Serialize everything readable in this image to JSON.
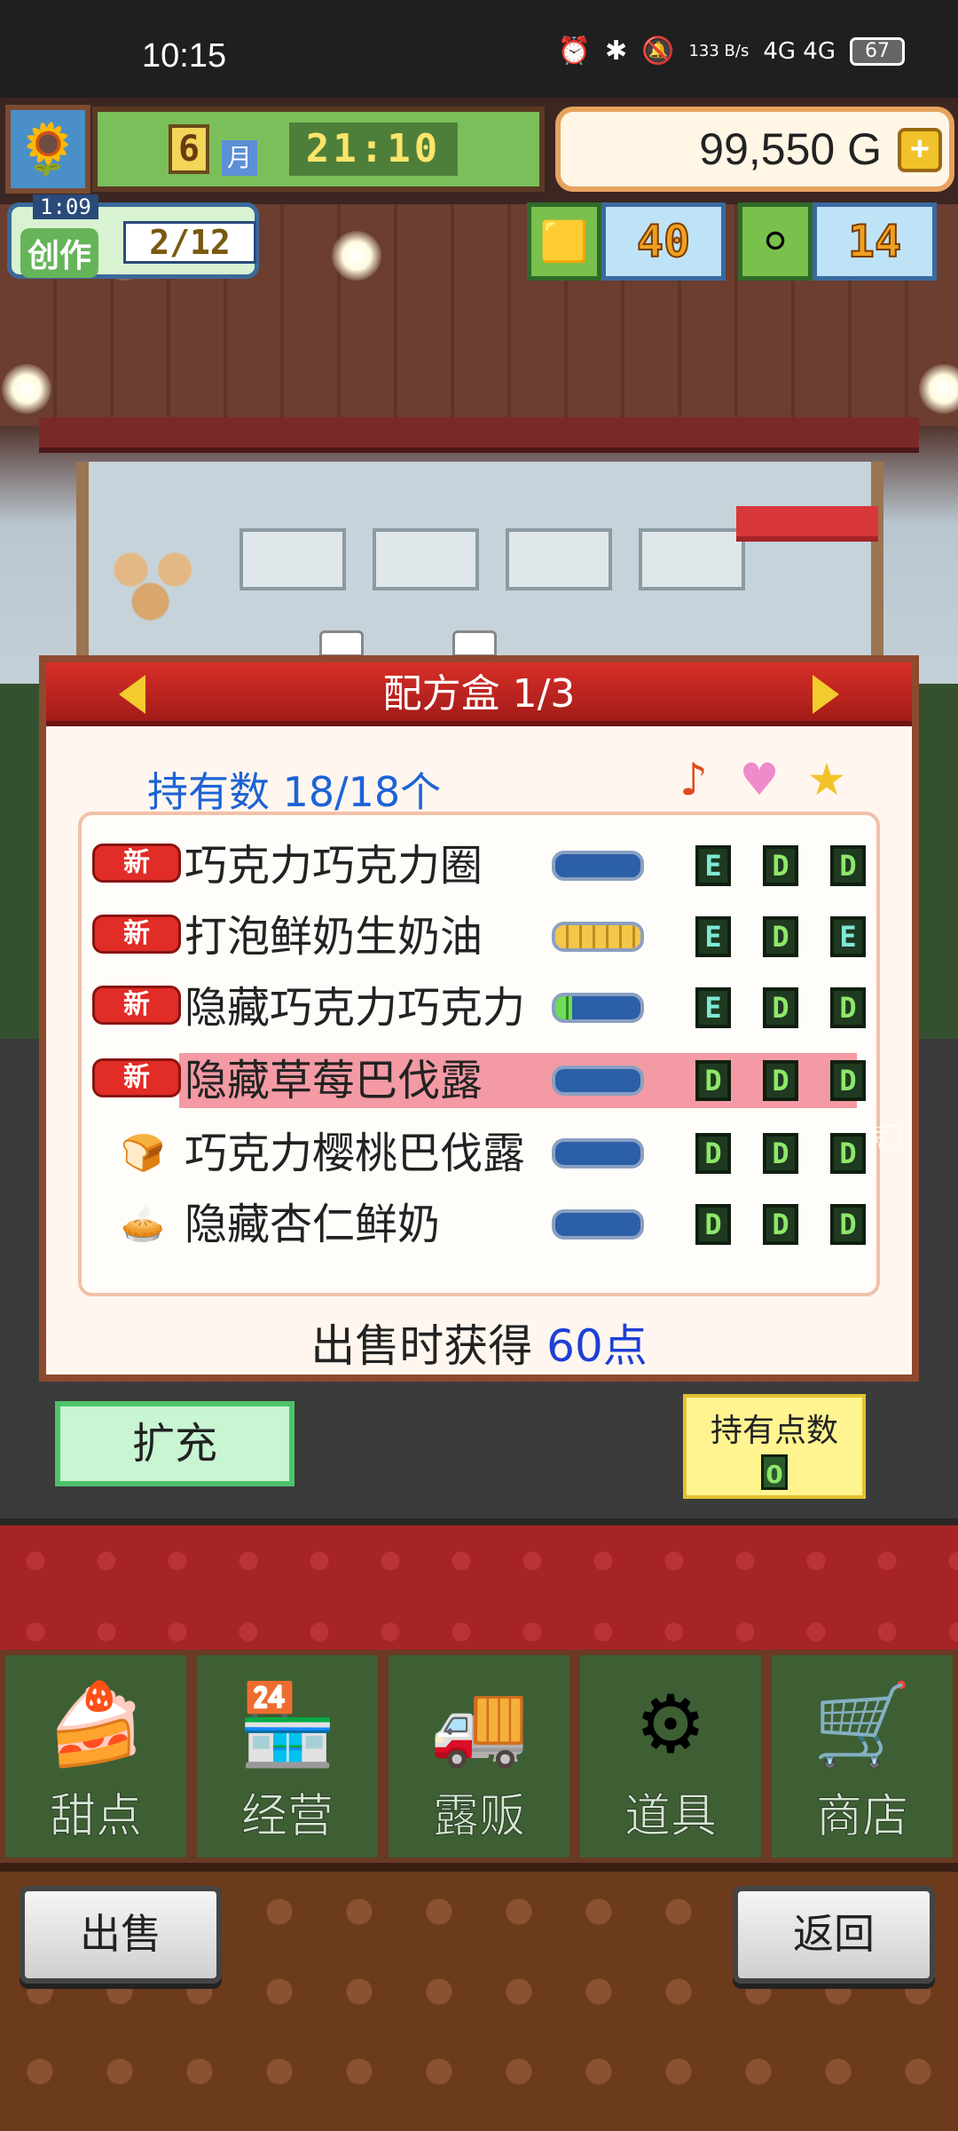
{
  "status_bar": {
    "time": "10:15",
    "speed": "133 B/s",
    "network": "4G 4G",
    "battery": "67"
  },
  "hud": {
    "month_number": "6",
    "month_label": "月",
    "clock": "21:10",
    "money": "99,550 G",
    "money_plus": "+",
    "create_timer": "1:09",
    "create_label": "创作",
    "create_count": "2/12",
    "gold_count": "40",
    "coin_count": "14"
  },
  "panel": {
    "title": "配方盒 1/3",
    "holding_label": "持有数 18/18个",
    "header_icons": [
      "music-note-icon",
      "heart-icon",
      "star-icon"
    ],
    "new_badge": "新",
    "rows": [
      {
        "name": "巧克力巧克力圈",
        "new": true,
        "bar_fill": 0,
        "bar_color": "yellow",
        "grades": [
          "E",
          "D",
          "D"
        ],
        "selected": false
      },
      {
        "name": "打泡鲜奶生奶油",
        "new": true,
        "bar_fill": 1.0,
        "bar_color": "yellow",
        "grades": [
          "E",
          "D",
          "E"
        ],
        "selected": false
      },
      {
        "name": "隐藏巧克力巧克力",
        "new": true,
        "bar_fill": 0.2,
        "bar_color": "green",
        "grades": [
          "E",
          "D",
          "D"
        ],
        "selected": false
      },
      {
        "name": "隐藏草莓巴伐露",
        "new": true,
        "bar_fill": 0,
        "bar_color": "yellow",
        "grades": [
          "D",
          "D",
          "D"
        ],
        "selected": true
      },
      {
        "name": "巧克力樱桃巴伐露",
        "new": false,
        "bar_fill": 0,
        "bar_color": "yellow",
        "grades": [
          "D",
          "D",
          "D"
        ],
        "selected": false
      },
      {
        "name": "隐藏杏仁鲜奶",
        "new": false,
        "bar_fill": 0,
        "bar_color": "yellow",
        "grades": [
          "D",
          "D",
          "D"
        ],
        "selected": false
      }
    ],
    "sale_prefix": "出售时获得",
    "sale_points": "60点"
  },
  "controls": {
    "expand_label": "扩充",
    "points_label": "持有点数",
    "points_value": "0"
  },
  "menu": [
    {
      "label": "甜点",
      "icon": "cake-icon"
    },
    {
      "label": "经营",
      "icon": "shop-building-icon"
    },
    {
      "label": "露贩",
      "icon": "food-truck-icon"
    },
    {
      "label": "道具",
      "icon": "gear-bag-icon"
    },
    {
      "label": "商店",
      "icon": "cart-icon"
    }
  ],
  "footer": {
    "sell_label": "出售",
    "back_label": "返回"
  }
}
